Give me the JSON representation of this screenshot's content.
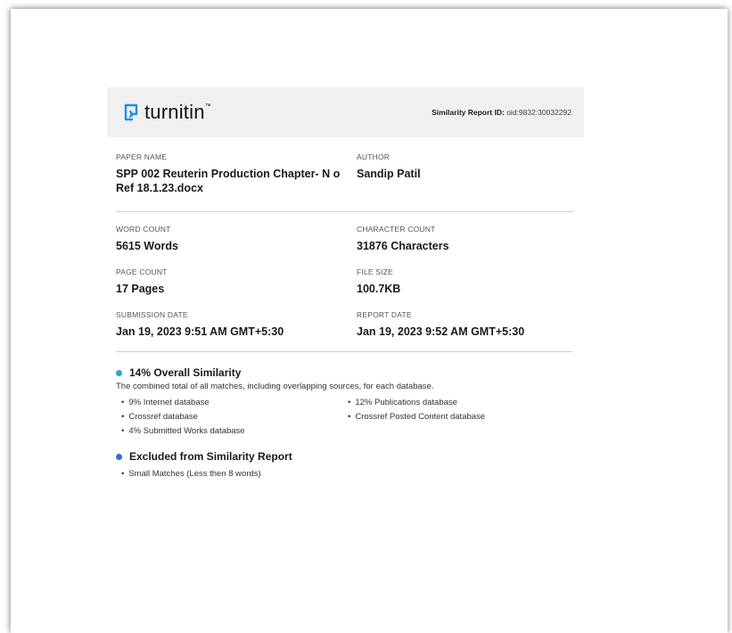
{
  "header": {
    "brand": "turnitin",
    "brand_tm": "™",
    "report_id_label": "Similarity Report ID:",
    "report_id_value": "oid:9832:30032292"
  },
  "meta": {
    "paper_name_label": "PAPER NAME",
    "paper_name": "SPP 002 Reuterin Production Chapter- N o Ref 18.1.23.docx",
    "author_label": "AUTHOR",
    "author": "Sandip Patil",
    "word_count_label": "WORD COUNT",
    "word_count": "5615 Words",
    "character_count_label": "CHARACTER COUNT",
    "character_count": "31876 Characters",
    "page_count_label": "PAGE COUNT",
    "page_count": "17 Pages",
    "file_size_label": "FILE SIZE",
    "file_size": "100.7KB",
    "submission_date_label": "SUBMISSION DATE",
    "submission_date": "Jan 19, 2023 9:51 AM GMT+5:30",
    "report_date_label": "REPORT DATE",
    "report_date": "Jan 19, 2023 9:52 AM GMT+5:30"
  },
  "similarity": {
    "title": "14% Overall Similarity",
    "description": "The combined total of all matches, including overlapping sources, for each database.",
    "items": [
      "9% Internet database",
      "12% Publications database",
      "Crossref database",
      "Crossref Posted Content database",
      "4% Submitted Works database"
    ],
    "dot_color": "#2aa7c9"
  },
  "excluded": {
    "title": "Excluded from Similarity Report",
    "items": [
      "Small Matches (Less then 8 words)"
    ],
    "dot_color": "#2f6fd6"
  },
  "colors": {
    "brand_icon": "#1f8fe0",
    "header_bg": "#f0f0f1"
  }
}
